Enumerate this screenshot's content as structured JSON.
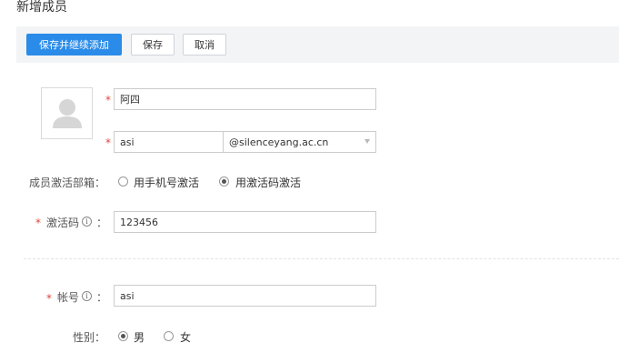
{
  "page": {
    "title": "新增成员"
  },
  "toolbar": {
    "save_continue_label": "保存并继续添加",
    "save_label": "保存",
    "cancel_label": "取消"
  },
  "form": {
    "name": {
      "value": "阿四"
    },
    "account_prefix": {
      "value": "asi"
    },
    "domain": {
      "selected": "@silenceyang.ac.cn"
    },
    "activation_method": {
      "label": "成员激活部箱：",
      "options": [
        {
          "label": "用手机号激活",
          "checked": false
        },
        {
          "label": "用激活码激活",
          "checked": true
        }
      ]
    },
    "activation_code": {
      "label": "激活码",
      "colon": "：",
      "value": "123456"
    },
    "username": {
      "label": "帐号",
      "colon": "：",
      "value": "asi"
    },
    "gender": {
      "label": "性别：",
      "options": [
        {
          "label": "男",
          "checked": true
        },
        {
          "label": "女",
          "checked": false
        }
      ]
    }
  },
  "colors": {
    "primary": "#2b8be8",
    "required": "#e0463c",
    "toolbar_bg": "#f3f4f6"
  }
}
